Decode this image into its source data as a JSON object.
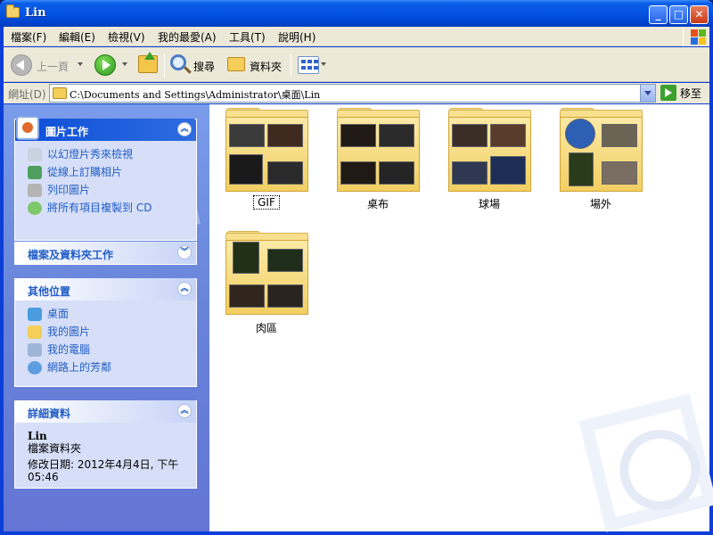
{
  "window": {
    "title": "Lin"
  },
  "menu": [
    "檔案(F)",
    "編輯(E)",
    "檢視(V)",
    "我的最愛(A)",
    "工具(T)",
    "說明(H)"
  ],
  "toolbar": {
    "back_label": "上一頁",
    "search_label": "搜尋",
    "folders_label": "資料夾"
  },
  "address": {
    "label": "網址(D)",
    "value": "C:\\Documents and Settings\\Administrator\\桌面\\Lin",
    "go_label": "移至"
  },
  "sidebar": {
    "picture_tasks": {
      "title": "圖片工作",
      "items": [
        "以幻燈片秀來檢視",
        "從線上訂購相片",
        "列印圖片",
        "將所有項目複製到 CD"
      ]
    },
    "file_folder_tasks": {
      "title": "檔案及資料夾工作"
    },
    "other_places": {
      "title": "其他位置",
      "items": [
        "桌面",
        "我的圖片",
        "我的電腦",
        "網路上的芳鄰"
      ]
    },
    "details": {
      "title": "詳細資料",
      "name": "Lin",
      "type": "檔案資料夾",
      "modified_line1": "修改日期: 2012年4月4日, 下午",
      "modified_line2": "05:46"
    }
  },
  "folders": [
    {
      "name": "GIF",
      "selected": true
    },
    {
      "name": "桌布"
    },
    {
      "name": "球場"
    },
    {
      "name": "場外"
    },
    {
      "name": "肉區"
    }
  ]
}
